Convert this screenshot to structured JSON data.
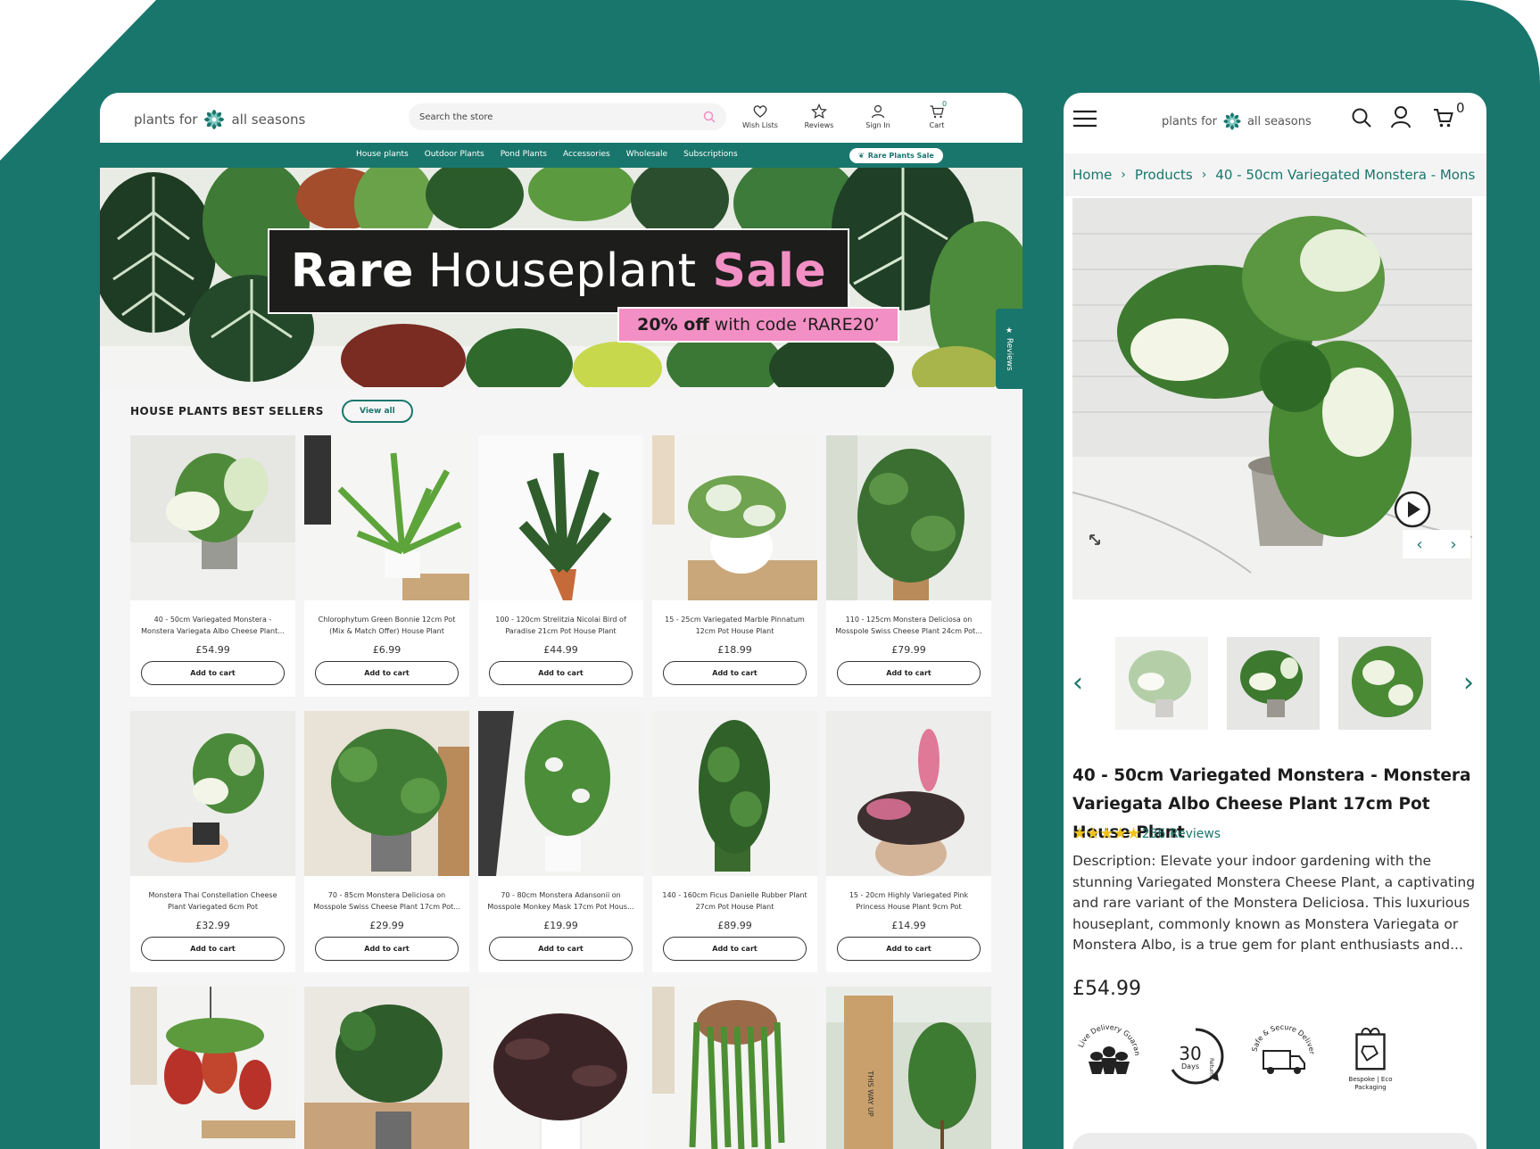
{
  "desktop": {
    "logo": {
      "left": "plants for",
      "right": "all seasons"
    },
    "search_placeholder": "Search the store",
    "header_icons": [
      {
        "label": "Wish Lists",
        "icon": "heart-icon"
      },
      {
        "label": "Reviews",
        "icon": "star-icon"
      },
      {
        "label": "Sign In",
        "icon": "user-icon"
      },
      {
        "label": "Cart",
        "icon": "cart-icon",
        "count": "0"
      }
    ],
    "nav": [
      "House plants",
      "Outdoor Plants",
      "Pond Plants",
      "Accessories",
      "Wholesale",
      "Subscriptions"
    ],
    "nav_pill": "Rare Plants Sale",
    "hero": {
      "title_1": "Rare",
      "title_2": "Houseplant",
      "title_3": "Sale",
      "sub_bold": "20% off",
      "sub_rest": "with code ‘RARE20’"
    },
    "reviews_tab": "★ Reviews",
    "section_title": "HOUSE PLANTS BEST SELLERS",
    "view_all": "View all",
    "add_to_cart": "Add to cart",
    "products": [
      {
        "name": "40 - 50cm Variegated Monstera - Monstera Variegata Albo Cheese Plant...",
        "price": "£54.99"
      },
      {
        "name": "Chlorophytum Green Bonnie 12cm Pot (Mix & Match Offer) House Plant",
        "price": "£6.99"
      },
      {
        "name": "100 - 120cm Strelitzia Nicolai Bird of Paradise 21cm Pot House Plant",
        "price": "£44.99"
      },
      {
        "name": "15 - 25cm Variegated Marble Pinnatum 12cm Pot House Plant",
        "price": "£18.99"
      },
      {
        "name": "110 - 125cm Monstera Deliciosa on Mosspole Swiss Cheese Plant 24cm Pot...",
        "price": "£79.99"
      },
      {
        "name": "Monstera Thai Constellation Cheese Plant Variegated 6cm Pot",
        "price": "£32.99"
      },
      {
        "name": "70 - 85cm Monstera Deliciosa on Mosspole Swiss Cheese Plant 17cm Pot...",
        "price": "£29.99"
      },
      {
        "name": "70 - 80cm Monstera Adansonii on Mosspole Monkey Mask 17cm Pot Hous...",
        "price": "£19.99"
      },
      {
        "name": "140 - 160cm Ficus Danielle Rubber Plant 27cm Pot House Plant",
        "price": "£89.99"
      },
      {
        "name": "15 - 20cm Highly Variegated Pink Princess House Plant 9cm Pot",
        "price": "£14.99"
      }
    ],
    "box_text": "THIS WAY UP"
  },
  "mobile": {
    "logo": {
      "left": "plants for",
      "right": "all seasons"
    },
    "cart_count": "0",
    "breadcrumb": [
      "Home",
      "Products",
      "40 - 50cm Variegated Monstera - Mons"
    ],
    "title": "40 - 50cm Variegated Monstera - Monstera Variegata Albo Cheese Plant 17cm Pot House Plant",
    "rating_stars": 5,
    "reviews": "236 Reviews",
    "description": "Description: Elevate your indoor gardening with the stunning Variegated Monstera Cheese Plant, a captivating and rare variant of the Monstera Deliciosa. This luxurious houseplant, commonly known as Monstera Variegata or Monstera Albo, is a true gem for plant enthusiasts and...",
    "price": "£54.99",
    "badges": {
      "delivery": "Live Delivery Guarantee",
      "returns_num": "30",
      "returns_word": "Days",
      "returns_ring": "Returns",
      "safe": "Safe & Secure Delivery",
      "eco": "Bespoke | Eco Packaging"
    }
  },
  "colors": {
    "teal": "#19766c",
    "pink": "#f28fc4",
    "dark": "#1d1d1b"
  }
}
